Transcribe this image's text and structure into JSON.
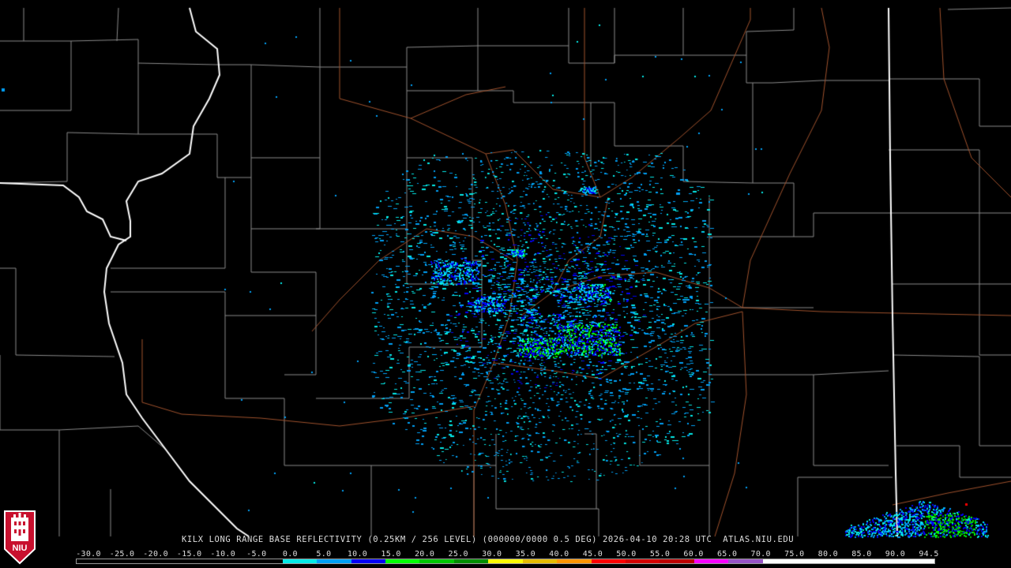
{
  "product": {
    "title": "KILX LONG RANGE BASE REFLECTIVITY (0.25KM / 256 LEVEL) (000000/0000 0.5 DEG) 2026-04-10 20:28 UTC  ATLAS.NIU.EDU"
  },
  "logo": {
    "text": "NIU",
    "color": "#c8102e"
  },
  "colorscale": {
    "labels": [
      "-30.0",
      "-25.0",
      "-20.0",
      "-15.0",
      "-10.0",
      "-5.0",
      "0.0",
      "5.0",
      "10.0",
      "15.0",
      "20.0",
      "25.0",
      "30.0",
      "35.0",
      "40.0",
      "45.0",
      "50.0",
      "55.0",
      "60.0",
      "65.0",
      "70.0",
      "75.0",
      "80.0",
      "85.0",
      "90.0",
      "94.5"
    ],
    "colors": [
      "#000000",
      "#000000",
      "#000000",
      "#000000",
      "#000000",
      "#000000",
      "#04e9e7",
      "#019ff4",
      "#0300f4",
      "#02fd02",
      "#01c501",
      "#008e00",
      "#fdf802",
      "#e5bc00",
      "#fd9500",
      "#fd0000",
      "#d40000",
      "#bc0000",
      "#f800fd",
      "#9854c6",
      "#fdfdfd",
      "#fdfdfd",
      "#fdfdfd",
      "#fdfdfd",
      "#fdfdfd"
    ]
  },
  "map": {
    "radar_site": "KILX",
    "colors": {
      "county": "#8a8a8a",
      "state": "#ffffff",
      "highway": "#a0522d",
      "background": "#000000"
    }
  }
}
